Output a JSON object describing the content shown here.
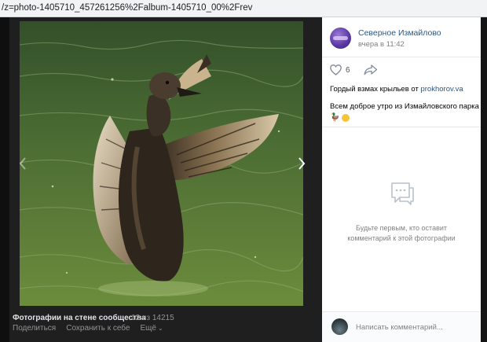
{
  "browser": {
    "url_fragment": "/z=photo-1405710_457261256%2Falbum-1405710_00%2Frev"
  },
  "viewer": {
    "album_title": "Фотографии на стене сообщества",
    "counter": "12 из 14215",
    "actions": {
      "share": "Поделиться",
      "save": "Сохранить к себе",
      "more": "Ещё"
    },
    "icons": {
      "prev": "chevron-left-icon",
      "next": "chevron-right-icon"
    }
  },
  "post": {
    "group_name": "Северное Измайлово",
    "time": "вчера в 11:42",
    "likes": "6",
    "caption_text": "Гордый взмах крыльев от ",
    "caption_link": "prokhorov.va",
    "message": "Всем доброе утро из Измайловского парка",
    "emoji": [
      "🦆",
      "smile"
    ]
  },
  "comments": {
    "empty_text": "Будьте первым, кто оставит комментарий к этой фотографии",
    "input_placeholder": "Написать комментарий..."
  },
  "colors": {
    "link": "#2a5885",
    "viewer_bg": "#1f1f1f",
    "muted": "#828282"
  }
}
